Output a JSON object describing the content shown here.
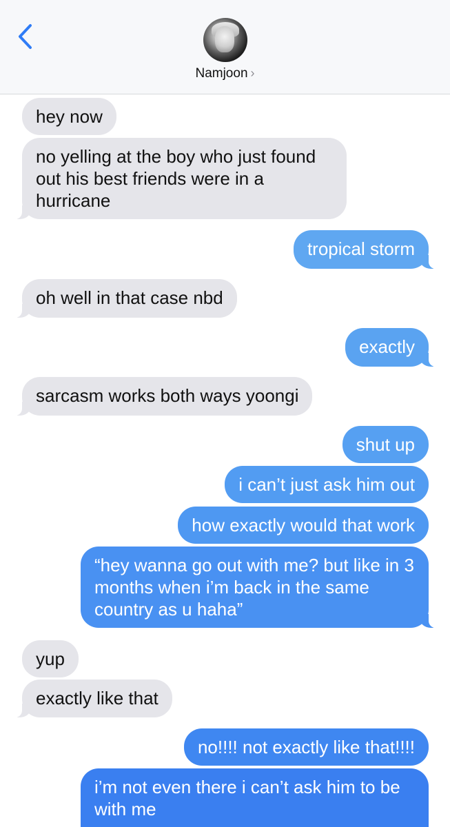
{
  "header": {
    "contact_name": "Namjoon",
    "chevron": "›"
  },
  "colors": {
    "incoming": "#e5e5ea",
    "outgoing_top": "#5fa6f2",
    "outgoing_bottom": "#3a7cf0"
  },
  "messages": [
    {
      "from": "them",
      "text": "hey now"
    },
    {
      "from": "them",
      "text": "no yelling at the boy who just found out his best friends were in a hurricane"
    },
    {
      "from": "me",
      "text": "tropical storm"
    },
    {
      "from": "them",
      "text": "oh well in that case nbd"
    },
    {
      "from": "me",
      "text": "exactly"
    },
    {
      "from": "them",
      "text": "sarcasm works both ways yoongi"
    },
    {
      "from": "me",
      "text": "shut up"
    },
    {
      "from": "me",
      "text": "i can’t just ask him out"
    },
    {
      "from": "me",
      "text": "how exactly would that work"
    },
    {
      "from": "me",
      "text": "“hey wanna go out with me? but like in 3 months when i’m back in the same country as u haha”"
    },
    {
      "from": "them",
      "text": "yup"
    },
    {
      "from": "them",
      "text": "exactly like that"
    },
    {
      "from": "me",
      "text": "no!!!! not exactly like that!!!!"
    },
    {
      "from": "me",
      "text": "i’m not even there i can’t ask him to be with me"
    }
  ]
}
